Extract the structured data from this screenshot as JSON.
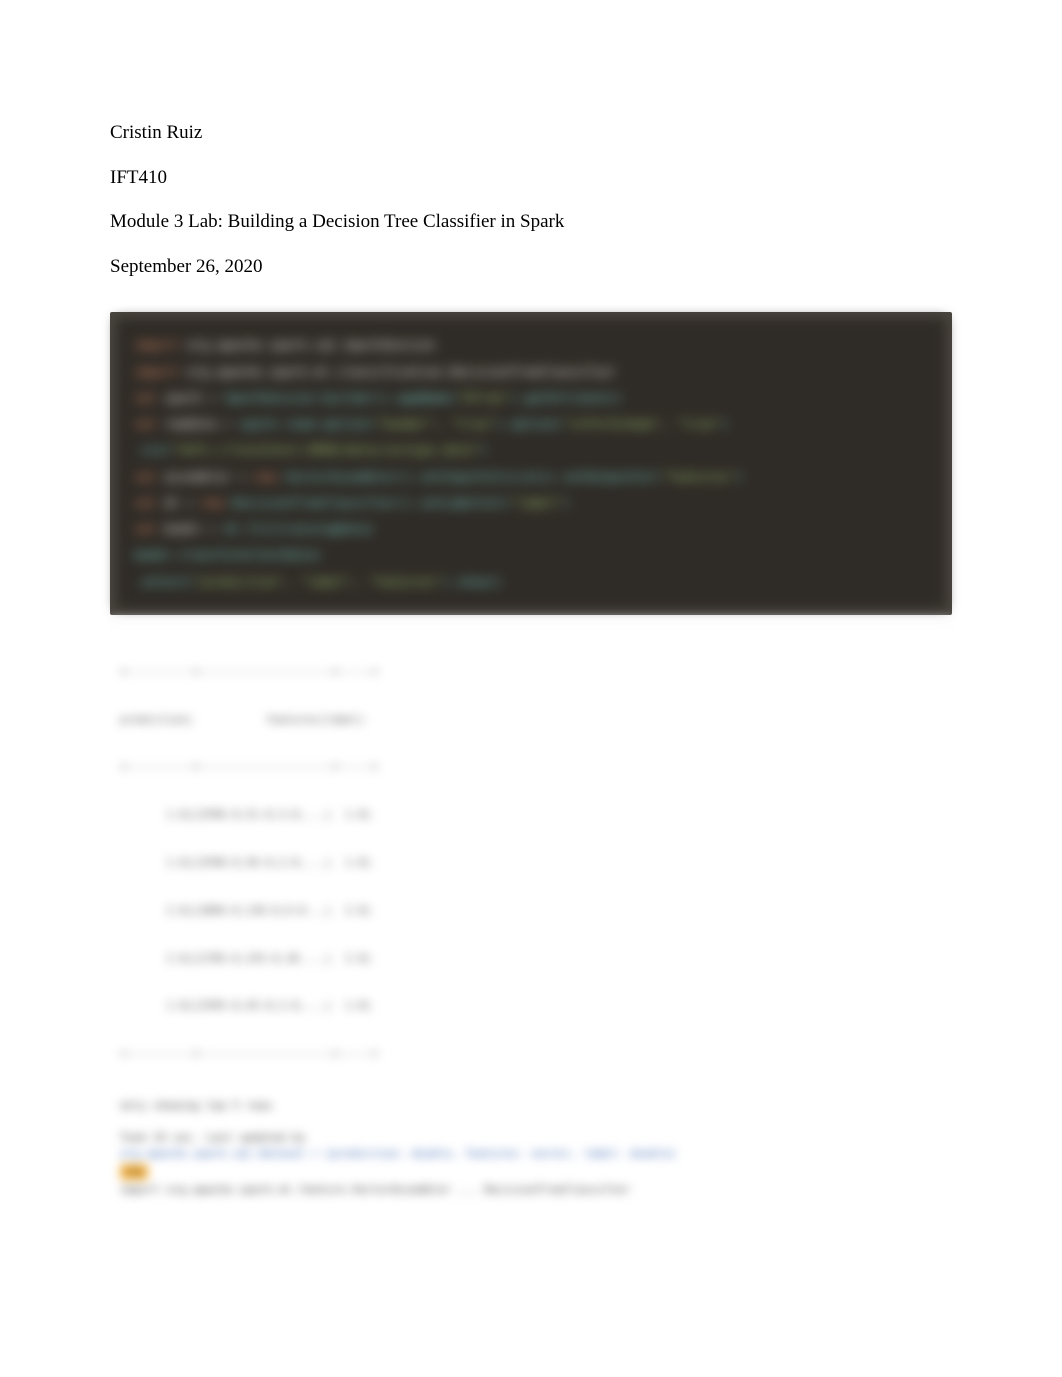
{
  "header": {
    "author": "Cristin Ruiz",
    "course": "IFT410",
    "title": "Module 3 Lab: Building a Decision Tree Classifier in Spark",
    "date": "September 26, 2020"
  },
  "code": {
    "l1a": "import",
    "l1b": " org.apache.spark.sql.SparkSession",
    "l2a": "import",
    "l2b": " org.apache.spark.ml.classification.DecisionTreeClassifier",
    "l3a": "val",
    "l3b": " spark ",
    "l3c": "=",
    "l3d": " SparkSession.builder().appName(",
    "l3e": "\"DTree\"",
    "l3f": ").getOrCreate()",
    "l4a": "val",
    "l4b": " rawData ",
    "l4c": "=",
    "l4d": " spark.read.option(",
    "l4e": "\"header\"",
    "l4f": ", ",
    "l4g": "\"true\"",
    "l4h": ").option(",
    "l4i": "\"inferSchema\"",
    "l4j": ", ",
    "l4k": "\"true\"",
    "l4l": ")",
    "l5a": "  .csv(",
    "l5b": "\"hdfs://localhost:9000/data/covtype.data\"",
    "l5c": ")",
    "l6a": "val",
    "l6b": " assembler ",
    "l6c": "=",
    "l6d": " new",
    "l6e": " VectorAssembler().setInputCols(cols).setOutputCol(",
    "l6f": "\"features\"",
    "l6g": ")",
    "l7a": "val",
    "l7b": " dt ",
    "l7c": "=",
    "l7d": " new",
    "l7e": " DecisionTreeClassifier().setLabelCol(",
    "l7f": "\"label\"",
    "l7g": ")",
    "l8a": "val",
    "l8b": " model ",
    "l8c": "=",
    "l8d": " dt.fit(trainingData)",
    "l9a": "model.transform(testData)",
    "l10a": "  .select(",
    "l10b": "\"prediction\"",
    "l10c": ", ",
    "l10d": "\"label\"",
    "l10e": ", ",
    "l10f": "\"features\"",
    "l10g": ")",
    "l10h": ".show()"
  },
  "console": {
    "header1": "prediction|           features|label|",
    "div": "+----------+--------------------+-----+",
    "r1": "       1.0|[2596.0,51.0,3.0,...|  1.0|",
    "r2": "       1.0|[2590.0,56.0,2.0,...|  1.0|",
    "r3": "       2.0|[2804.0,139.0,9.0...|  2.0|",
    "r4": "       2.0|[2785.0,155.0,18....|  2.0|",
    "r5": "       1.0|[2595.0,45.0,2.0,...|  1.0|",
    "note": "only showing top 5 rows",
    "timeLabel": "Took 24 sec. Last updated by",
    "sparkLine": "org.apache.spark.sql.Dataset = [prediction: double, features: vector, label: double]",
    "badge": "res",
    "finalLine": "import org.apache.spark.ml.feature.VectorAssembler ... DecisionTreeClassifier"
  }
}
